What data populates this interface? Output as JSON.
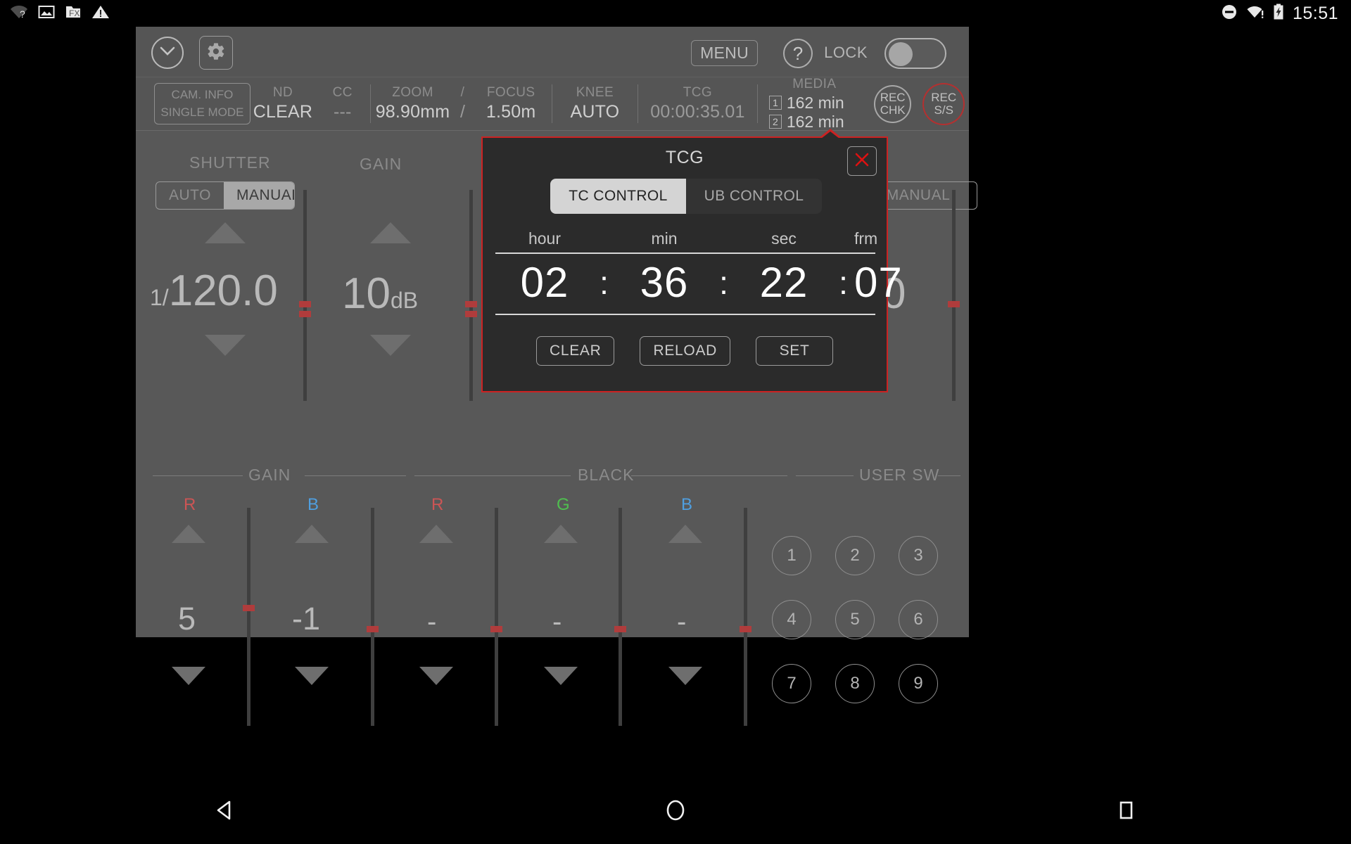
{
  "status_bar": {
    "left_icons": [
      "wifi-question-icon",
      "image-icon",
      "fx-folder-icon",
      "warning-icon"
    ],
    "right_icons": [
      "do-not-disturb-icon",
      "wifi-alert-icon",
      "battery-charging-icon"
    ],
    "clock": "15:51"
  },
  "header": {
    "collapse_icon": "chevron-down-icon",
    "settings_icon": "gear-icon",
    "menu_label": "MENU",
    "help_label": "?",
    "lock_label": "LOCK",
    "lock_state": "off"
  },
  "info_bar": {
    "cam_info_line1": "CAM. INFO",
    "cam_info_line2": "SINGLE MODE",
    "cells": [
      {
        "label": "ND",
        "value": "CLEAR"
      },
      {
        "label": "CC",
        "value": "---"
      },
      {
        "label": "ZOOM",
        "value": "98.90mm"
      },
      {
        "label": "FOCUS",
        "value": "1.50m"
      },
      {
        "label": "KNEE",
        "value": "AUTO"
      },
      {
        "label": "TCG",
        "value": "00:00:35.01"
      }
    ],
    "zoom_focus_separator": "/",
    "media": {
      "label": "MEDIA",
      "slot1_num": "1",
      "slot1_value": "162 min",
      "slot2_num": "2",
      "slot2_value": "162 min"
    },
    "rec_chk": {
      "line1": "REC",
      "line2": "CHK"
    },
    "rec_ss": {
      "line1": "REC",
      "line2": "S/S"
    }
  },
  "shutter": {
    "title": "SHUTTER",
    "mode_auto": "AUTO",
    "mode_manual": "MANUAL",
    "active_mode": "MANUAL",
    "prefix": "1/",
    "value": "120.0"
  },
  "gain_top": {
    "title": "GAIN",
    "value": "10",
    "unit": "dB"
  },
  "right_top": {
    "mode_manual": "MANUAL",
    "value": "0"
  },
  "gain_section": {
    "title": "GAIN",
    "channels": [
      {
        "label": "R",
        "color": "#cc5555",
        "value": "5"
      },
      {
        "label": "B",
        "color": "#4f9fe0",
        "value": "-1"
      }
    ]
  },
  "black_section": {
    "title": "BLACK",
    "channels": [
      {
        "label": "R",
        "color": "#cc5555",
        "value": "-"
      },
      {
        "label": "G",
        "color": "#4fbf4f",
        "value": "-"
      },
      {
        "label": "B",
        "color": "#4f9fe0",
        "value": "-"
      }
    ]
  },
  "user_sw": {
    "title": "USER SW",
    "buttons": [
      "1",
      "2",
      "3",
      "4",
      "5",
      "6",
      "7",
      "8",
      "9"
    ]
  },
  "tcg_dialog": {
    "title": "TCG",
    "close_icon": "close-icon",
    "tabs": [
      {
        "label": "TC CONTROL",
        "active": true
      },
      {
        "label": "UB CONTROL",
        "active": false
      }
    ],
    "field_labels": [
      "hour",
      "min",
      "sec",
      "frm"
    ],
    "field_values": [
      "02",
      "36",
      "22",
      "07"
    ],
    "separator": ":",
    "buttons": [
      "CLEAR",
      "RELOAD",
      "SET"
    ],
    "border_color": "#cc2222"
  },
  "nav_bar": {
    "back_icon": "back-triangle-icon",
    "home_icon": "home-circle-icon",
    "recents_icon": "recents-square-icon"
  }
}
